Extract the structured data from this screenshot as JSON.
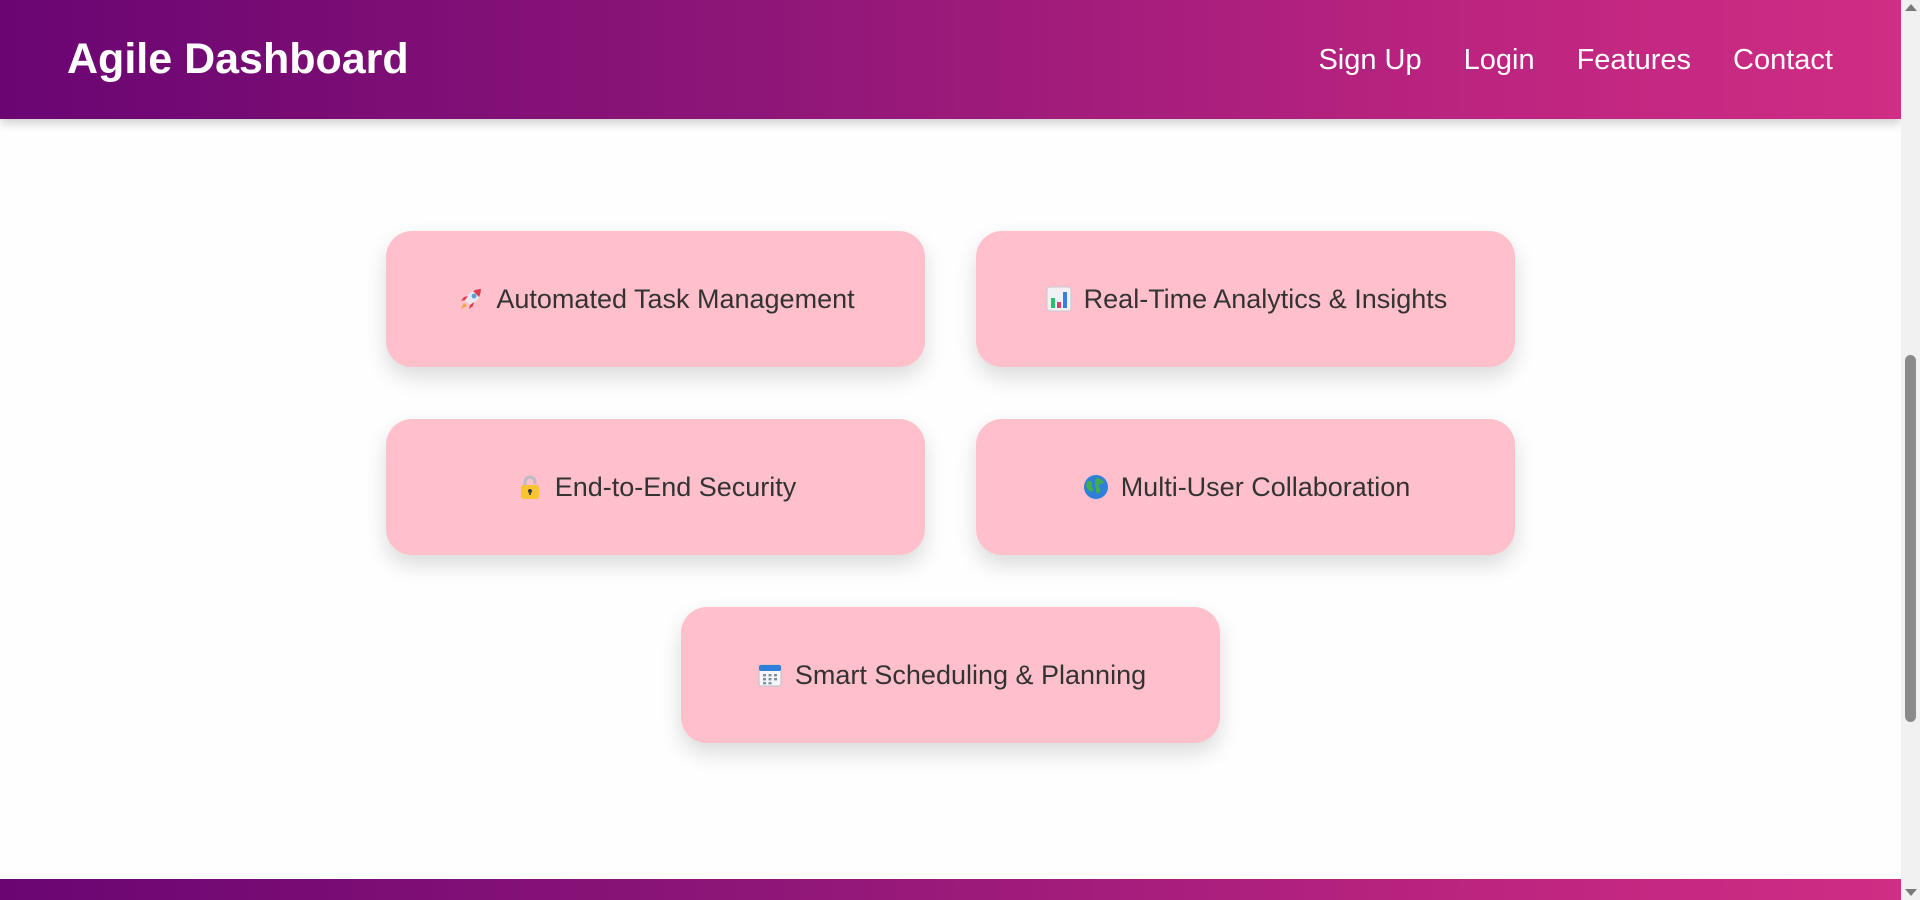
{
  "header": {
    "title": "Agile Dashboard",
    "nav": [
      {
        "label": "Sign Up"
      },
      {
        "label": "Login"
      },
      {
        "label": "Features"
      },
      {
        "label": "Contact"
      }
    ]
  },
  "features": [
    {
      "icon": "rocket-icon",
      "label": "Automated Task Management"
    },
    {
      "icon": "bar-chart-icon",
      "label": "Real-Time Analytics & Insights"
    },
    {
      "icon": "lock-icon",
      "label": "End-to-End Security"
    },
    {
      "icon": "globe-icon",
      "label": "Multi-User Collaboration"
    },
    {
      "icon": "calendar-icon",
      "label": "Smart Scheduling & Planning"
    }
  ],
  "colors": {
    "gradient_start": "#6a0572",
    "gradient_end": "#d02d84",
    "card_background": "#ffc0cb",
    "card_text": "#333333"
  }
}
